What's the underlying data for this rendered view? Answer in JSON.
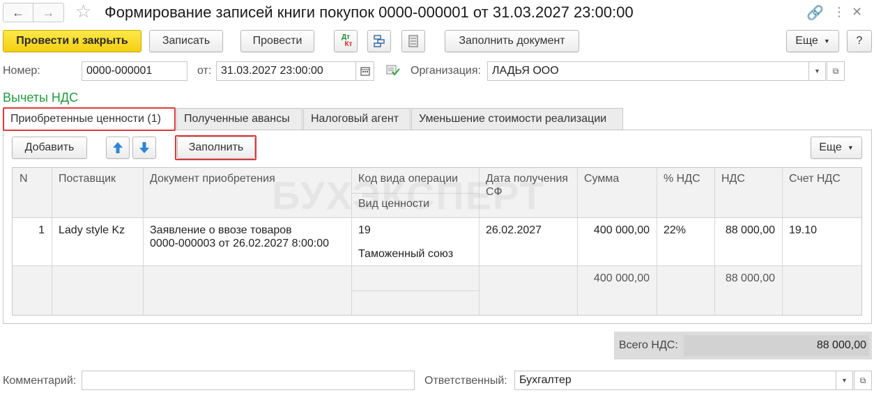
{
  "window": {
    "title": "Формирование записей книги покупок 0000-000001 от 31.03.2027 23:00:00"
  },
  "toolbar": {
    "post_and_close": "Провести и закрыть",
    "save": "Записать",
    "post": "Провести",
    "dt_label": "Дт",
    "kt_label": "Кт",
    "fill_document": "Заполнить документ",
    "more": "Еще",
    "help": "?"
  },
  "header": {
    "number_label": "Номер:",
    "number_value": "0000-000001",
    "date_label": "от:",
    "date_value": "31.03.2027 23:00:00",
    "org_label": "Организация:",
    "org_value": "ЛАДЬЯ ООО"
  },
  "section": {
    "title": "Вычеты НДС"
  },
  "tabs": [
    {
      "label": "Приобретенные ценности (1)"
    },
    {
      "label": "Полученные авансы"
    },
    {
      "label": "Налоговый агент"
    },
    {
      "label": "Уменьшение стоимости реализации"
    }
  ],
  "table_toolbar": {
    "add": "Добавить",
    "fill": "Заполнить",
    "more": "Еще"
  },
  "table": {
    "columns": {
      "n": "N",
      "supplier": "Поставщик",
      "doc": "Документ приобретения",
      "op_code": "Код вида операции",
      "value_type": "Вид ценности",
      "date_sf": "Дата получения СФ",
      "sum": "Сумма",
      "vat_rate": "% НДС",
      "vat": "НДС",
      "vat_account": "Счет НДС"
    },
    "rows": [
      {
        "n": "1",
        "supplier": "Lady style Kz",
        "doc_line1": "Заявление о ввозе товаров",
        "doc_line2": "0000-000003 от 26.02.2027 8:00:00",
        "op_code": "19",
        "value_type": "Таможенный союз",
        "date_sf": "26.02.2027",
        "sum": "400 000,00",
        "vat_rate": "22%",
        "vat": "88 000,00",
        "vat_account": "19.10"
      }
    ],
    "footer": {
      "sum": "400 000,00",
      "vat": "88 000,00"
    }
  },
  "watermark": "БУХЭКСПЕРТ",
  "totals": {
    "label": "Всего НДС:",
    "value": "88 000,00"
  },
  "bottom": {
    "comment_label": "Комментарий:",
    "comment_value": "",
    "responsible_label": "Ответственный:",
    "responsible_value": "Бухгалтер"
  },
  "colors": {
    "primary_button": "#f5d30f",
    "section_title": "#1f9b3e",
    "highlight": "#e0393b"
  }
}
